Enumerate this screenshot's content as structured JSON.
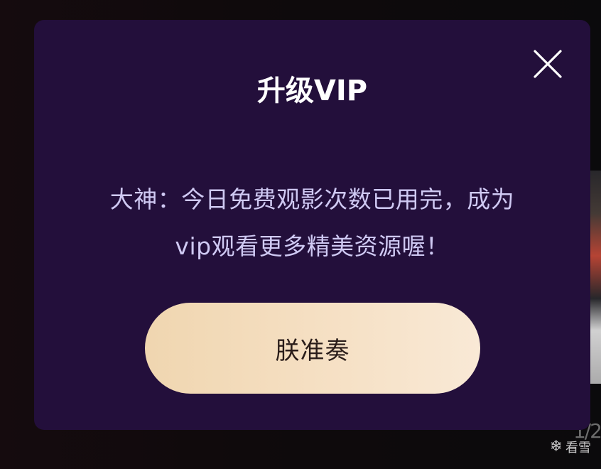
{
  "background": {
    "right_edge_text": "1/2",
    "watermark": "看雪"
  },
  "dialog": {
    "title": "升级VIP",
    "message_line1": "大神：今日免费观影次数已用完，成为",
    "message_line2": "vip观看更多精美资源喔！",
    "cta_label": "朕准奏",
    "close_icon": "close-icon"
  },
  "colors": {
    "dialog_bg": "#230f3b",
    "title": "#ffffff",
    "message": "#cfc9f3",
    "cta_bg_start": "#f0d6b0",
    "cta_bg_end": "#f9e9d6",
    "cta_text": "#2a1d1a"
  }
}
